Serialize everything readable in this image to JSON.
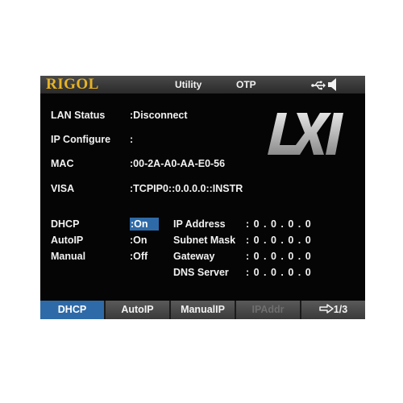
{
  "header": {
    "brand": "RIGOL",
    "title": "Utility",
    "mode": "OTP",
    "usb_icon": "usb-icon",
    "speaker_icon": "speaker-icon"
  },
  "logo": "LXI",
  "lan": {
    "status_label": "LAN Status",
    "status_value": ":Disconnect",
    "ip_configure_label": "IP Configure",
    "ip_configure_value": ":",
    "mac_label": "MAC",
    "mac_value": ":00-2A-A0-AA-E0-56",
    "visa_label": "VISA",
    "visa_value": ":TCPIP0::0.0.0.0::INSTR"
  },
  "modes": {
    "dhcp_label": "DHCP",
    "dhcp_value": ":On",
    "autoip_label": "AutoIP",
    "autoip_value": ":On",
    "manual_label": "Manual",
    "manual_value": ":Off"
  },
  "network": {
    "ip_address_label": "IP Address",
    "ip_address_value": ": 0 . 0 . 0 . 0",
    "subnet_mask_label": "Subnet Mask",
    "subnet_mask_value": ": 0 . 0 . 0 . 0",
    "gateway_label": "Gateway",
    "gateway_value": ": 0 . 0 . 0 . 0",
    "dns_server_label": "DNS Server",
    "dns_server_value": ": 0 . 0 . 0 . 0"
  },
  "softkeys": {
    "dhcp": "DHCP",
    "autoip": "AutoIP",
    "manualip": "ManualIP",
    "ipaddr": "IPAddr",
    "page": "1/3",
    "page_icon": "arrow-right-icon"
  },
  "colors": {
    "brand": "#e8b323",
    "highlight": "#2f6aa8",
    "background": "#050505",
    "text": "#f2f2f2",
    "disabled": "#6e6e6e"
  }
}
